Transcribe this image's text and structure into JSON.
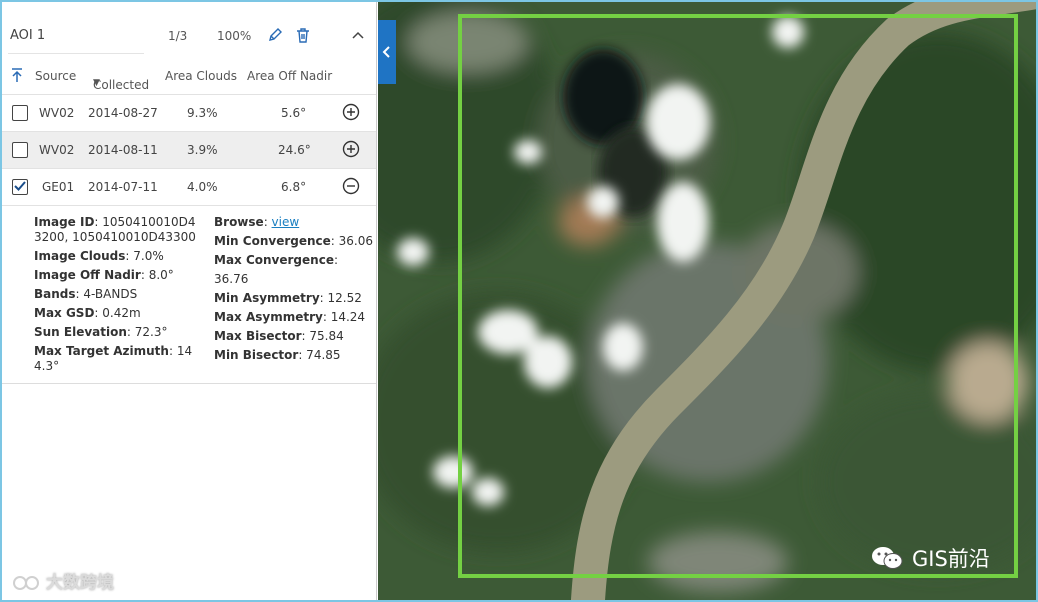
{
  "aoi": {
    "name": "AOI 1",
    "page": "1/3",
    "percent": "100%"
  },
  "columns": {
    "source": "Source",
    "collected": "Collected",
    "area_clouds": "Area Clouds",
    "area_off_nadir": "Area Off Nadir"
  },
  "rows": [
    {
      "source": "WV02",
      "date": "2014-08-27",
      "clouds": "9.3%",
      "nadir": "5.6°",
      "checked": false,
      "action": "add"
    },
    {
      "source": "WV02",
      "date": "2014-08-11",
      "clouds": "3.9%",
      "nadir": "24.6°",
      "checked": false,
      "action": "add"
    },
    {
      "source": "GE01",
      "date": "2014-07-11",
      "clouds": "4.0%",
      "nadir": "6.8°",
      "checked": true,
      "action": "remove"
    }
  ],
  "details": {
    "image_id_label": "Image ID",
    "image_id_line1": ": 1050410010D4",
    "image_id_line2": "3200, 1050410010D43300",
    "image_clouds_label": "Image Clouds",
    "image_clouds": ": 7.0%",
    "image_off_nadir_label": "Image Off Nadir",
    "image_off_nadir": ": 8.0°",
    "bands_label": "Bands",
    "bands": ": 4-BANDS",
    "max_gsd_label": "Max GSD",
    "max_gsd": ": 0.42m",
    "sun_elevation_label": "Sun Elevation",
    "sun_elevation": ": 72.3°",
    "max_target_azimuth_label": "Max Target Azimuth",
    "max_target_azimuth_line1": ": 14",
    "max_target_azimuth_line2": "4.3°",
    "browse_label": "Browse",
    "browse_sep": ": ",
    "browse_link": "view",
    "min_convergence_label": "Min Convergence",
    "min_convergence": ": 36.06",
    "max_convergence_label": "Max Convergence",
    "max_convergence": ": 36.76",
    "min_asymmetry_label": "Min Asymmetry",
    "min_asymmetry": ": 12.52",
    "max_asymmetry_label": "Max Asymmetry",
    "max_asymmetry": ": 14.24",
    "max_bisector_label": "Max Bisector",
    "max_bisector": ": 75.84",
    "min_bisector_label": "Min Bisector",
    "min_bisector": ": 74.85"
  },
  "watermarks": {
    "left": "大数跨境",
    "right": "GIS前沿"
  },
  "colors": {
    "aoi_outline": "#74d043",
    "accent": "#1f74c4",
    "link": "#1a7fc1"
  }
}
